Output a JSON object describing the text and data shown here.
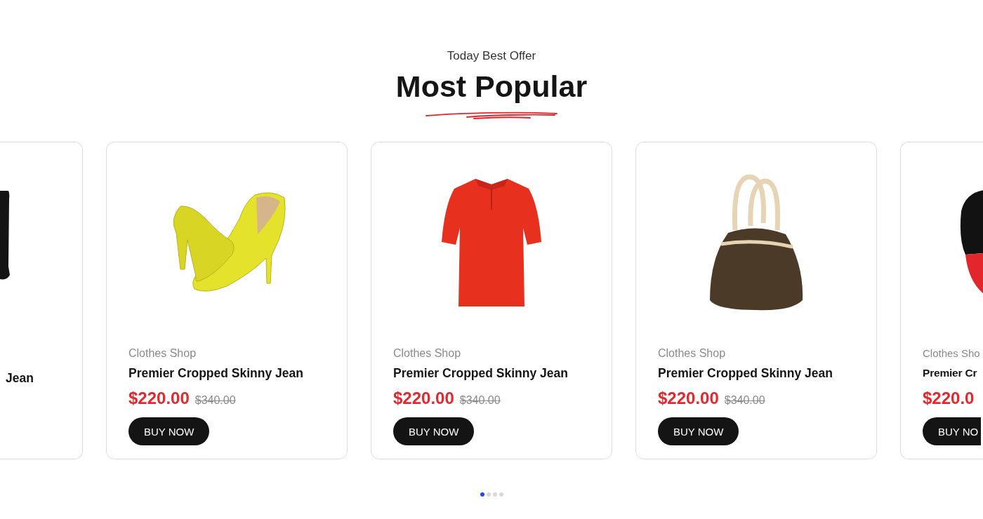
{
  "header": {
    "subtitle": "Today Best Offer",
    "title": "Most Popular"
  },
  "products": [
    {
      "kind": "left",
      "name": "Jean"
    },
    {
      "kind": "whole",
      "category": "Clothes Shop",
      "name": "Premier Cropped Skinny Jean",
      "price": "$220.00",
      "old_price": "$340.00",
      "button": "BUY NOW"
    },
    {
      "kind": "whole",
      "category": "Clothes Shop",
      "name": "Premier Cropped Skinny Jean",
      "price": "$220.00",
      "old_price": "$340.00",
      "button": "BUY NOW"
    },
    {
      "kind": "whole",
      "category": "Clothes Shop",
      "name": "Premier Cropped Skinny Jean",
      "price": "$220.00",
      "old_price": "$340.00",
      "button": "BUY NOW"
    },
    {
      "kind": "right",
      "category": "Clothes Sho",
      "name": "Premier Cr",
      "price": "$220.0",
      "button": "BUY NO"
    }
  ],
  "pagination": [
    {
      "selected": true
    },
    {
      "selected": false
    },
    {
      "selected": false
    },
    {
      "selected": false
    }
  ]
}
